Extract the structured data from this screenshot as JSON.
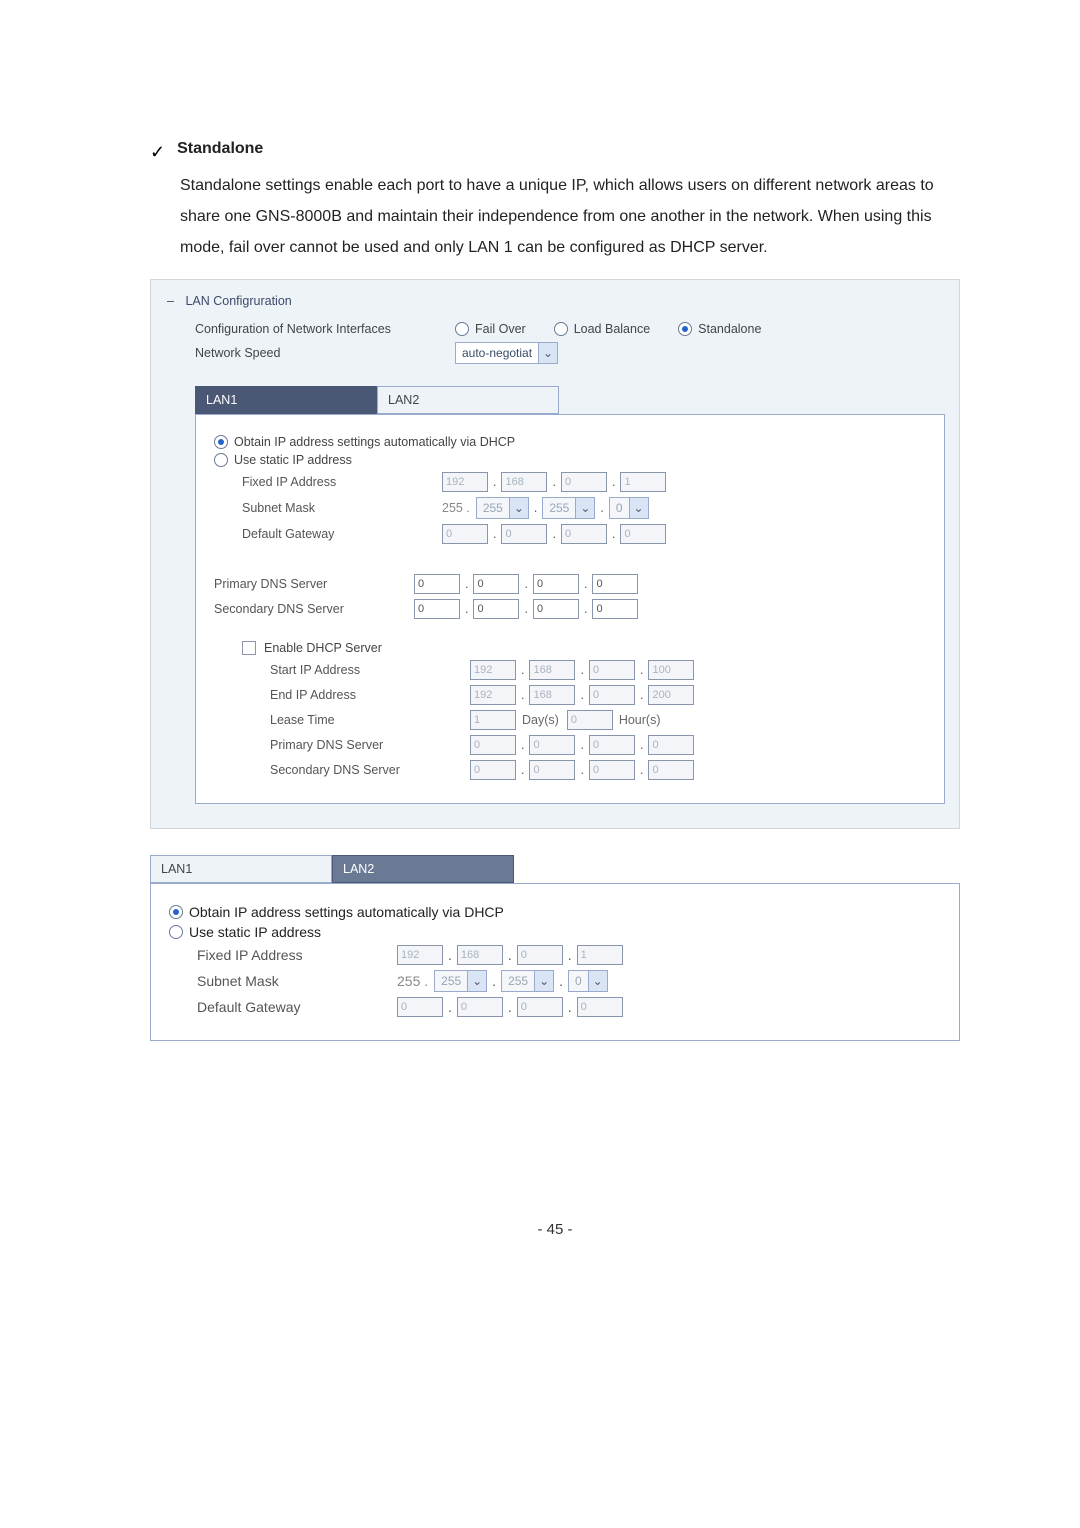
{
  "intro": {
    "checkmark": "✓",
    "title": "Standalone",
    "paragraph": "Standalone settings enable each port to have a unique IP, which allows users on different network areas to share one GNS-8000B and maintain their independence from one another in the network.  When using this mode, fail over cannot be used and only LAN 1 can be configured as DHCP server."
  },
  "panel": {
    "section_dash": "–",
    "section_title": "LAN Configruration",
    "config_label": "Configuration of Network Interfaces",
    "modes": {
      "fail_over": "Fail Over",
      "load_balance": "Load Balance",
      "standalone": "Standalone"
    },
    "network_speed_label": "Network Speed",
    "network_speed_value": "auto-negotiat"
  },
  "tabs_top": {
    "lan1": "LAN1",
    "lan2": "LAN2"
  },
  "lan1": {
    "opt_dhcp": "Obtain IP address settings automatically via DHCP",
    "opt_static": "Use static IP address",
    "fixed_ip_label": "Fixed IP Address",
    "fixed_ip": [
      "192",
      "168",
      "0",
      "1"
    ],
    "subnet_label": "Subnet Mask",
    "subnet_prefix": "255 .",
    "subnet_sel1": "255",
    "subnet_sel2": "255",
    "subnet_last": "0",
    "gateway_label": "Default Gateway",
    "gateway": [
      "0",
      "0",
      "0",
      "0"
    ],
    "primary_dns_label": "Primary DNS Server",
    "primary_dns": [
      "0",
      "0",
      "0",
      "0"
    ],
    "secondary_dns_label": "Secondary DNS Server",
    "secondary_dns": [
      "0",
      "0",
      "0",
      "0"
    ],
    "dhcp": {
      "enable_label": "Enable DHCP Server",
      "start_label": "Start IP Address",
      "start": [
        "192",
        "168",
        "0",
        "100"
      ],
      "end_label": "End IP Address",
      "end": [
        "192",
        "168",
        "0",
        "200"
      ],
      "lease_label": "Lease Time",
      "lease_days": "1",
      "lease_days_unit": "Day(s)",
      "lease_hours": "0",
      "lease_hours_unit": "Hour(s)",
      "pri_label": "Primary DNS Server",
      "pri": [
        "0",
        "0",
        "0",
        "0"
      ],
      "sec_label": "Secondary DNS Server",
      "sec": [
        "0",
        "0",
        "0",
        "0"
      ]
    }
  },
  "tabs_bottom": {
    "lan1": "LAN1",
    "lan2": "LAN2"
  },
  "lan2": {
    "opt_dhcp": "Obtain IP address settings automatically via DHCP",
    "opt_static": "Use static IP address",
    "fixed_ip_label": "Fixed IP Address",
    "fixed_ip": [
      "192",
      "168",
      "0",
      "1"
    ],
    "subnet_label": "Subnet Mask",
    "subnet_prefix": "255 .",
    "subnet_sel1": "255",
    "subnet_sel2": "255",
    "subnet_last": "0",
    "gateway_label": "Default Gateway",
    "gateway": [
      "0",
      "0",
      "0",
      "0"
    ]
  },
  "page_number": "- 45 -"
}
